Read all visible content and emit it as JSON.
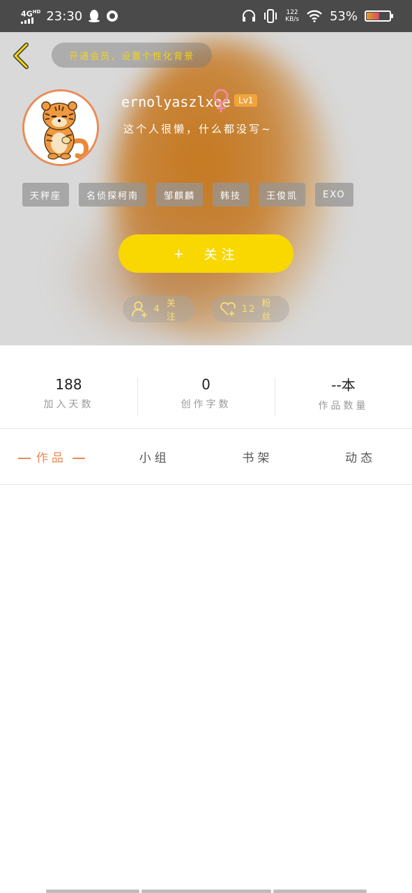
{
  "status_bar": {
    "network": "4G",
    "network_sub": "HD",
    "time": "23:30",
    "speed_value": "122",
    "speed_unit": "KB/s",
    "battery": "53%"
  },
  "header": {
    "vip_banner": "开通会员，设置个性化背景",
    "username": "ernolyaszlxoe",
    "level": "Lv1",
    "bio": "这个人很懒，什么都没写~",
    "tags": [
      "天秤座",
      "名侦探柯南",
      "邹麒麟",
      "韩技",
      "王俊凯",
      "EXO"
    ],
    "follow_plus": "+",
    "follow_label": "关注",
    "following_count": "4",
    "following_label": "关注",
    "fans_count": "12",
    "fans_label": "粉丝",
    "accent_color": "#f8d800"
  },
  "stats": [
    {
      "value": "188",
      "label": "加入天数"
    },
    {
      "value": "0",
      "label": "创作字数"
    },
    {
      "value": "--本",
      "label": "作品数量"
    }
  ],
  "tabs": [
    {
      "label": "作品",
      "active": true
    },
    {
      "label": "小组",
      "active": false
    },
    {
      "label": "书架",
      "active": false
    },
    {
      "label": "动态",
      "active": false
    }
  ],
  "icons": [
    "back-icon",
    "gender-female-icon",
    "user-plus-icon",
    "heart-plus-icon",
    "wifi-icon",
    "headphones-icon",
    "vibrate-icon",
    "battery-icon"
  ]
}
